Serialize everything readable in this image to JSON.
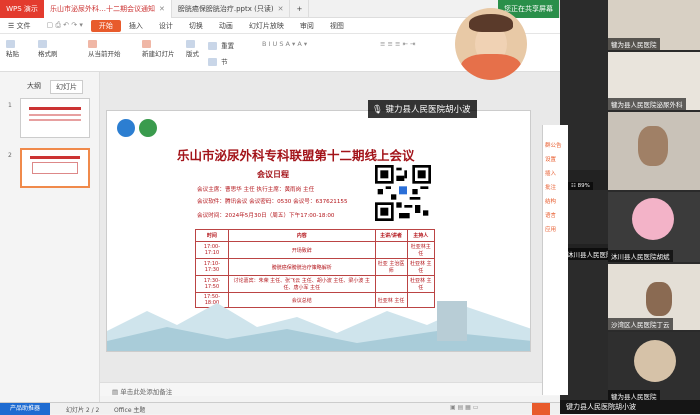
{
  "titlebar": {
    "app_name": "WPS 演示",
    "tabs": [
      {
        "label": "乐山市泌尿外科…十二期会议通知",
        "active": true
      },
      {
        "label": "膀胱癌保膀胱治疗.pptx (只读)",
        "active": false
      }
    ],
    "shared_screen_label": "您正在共享屏幕"
  },
  "menubar": {
    "file": "文件",
    "items": [
      "开始",
      "插入",
      "设计",
      "切换",
      "动画",
      "幻灯片放映",
      "审阅",
      "视图"
    ],
    "active": "开始"
  },
  "toolbar": {
    "paste": "粘贴",
    "format_painter": "格式刷",
    "from_current": "从当前开始",
    "new_slide": "新建幻灯片",
    "layout": "版式",
    "reset": "重置",
    "section": "节"
  },
  "leftpane": {
    "tabs": [
      "大纲",
      "幻灯片"
    ],
    "active_tab": "幻灯片",
    "slides": [
      {
        "num": "1"
      },
      {
        "num": "2"
      }
    ]
  },
  "slide": {
    "title": "乐山市泌尿外科专科联盟第十二期线上会议",
    "schedule_heading": "会议日程",
    "chair": "会议主席：曹思华 主任   执行主席：黄雨岗 主任",
    "software": "会议软件：腾讯会议   会议密码：0530   会议号：637621155",
    "time": "会议时间：2024年5月30日（周五）下午17:00-18:00",
    "agenda_headers": [
      "时间",
      "内容",
      "主讲/讲者",
      "主持人"
    ],
    "agenda_rows": [
      [
        "17:00-17:10",
        "开场致辞",
        "",
        "杜亚林主任"
      ],
      [
        "17:10-17:30",
        "膀胱癌保膀胱治疗策略解析",
        "杜亚 主治医师",
        "杜亚林 主任"
      ],
      [
        "17:30-17:50",
        "讨论嘉宾：朱荣 主任、张飞云 主任、胡小波 主任、梁小波 主任、唐小军 主任",
        "",
        "杜亚林 主任"
      ],
      [
        "17:50-18:00",
        "会议总结",
        "杜亚林 主任",
        ""
      ]
    ]
  },
  "notes": {
    "placeholder": "单击此处添加备注"
  },
  "statusbar": {
    "reset_button": "产品助推器",
    "slide_indicator": "幻灯片 2 / 2",
    "theme": "Office 主题"
  },
  "video": {
    "speaker_name": "键力县人民医院胡小波",
    "participants": [
      {
        "name": "犍为县人民医院"
      },
      {
        "name": "沐川县人民医院"
      },
      {
        "name": "犍为县人民医院泌尿外科"
      },
      {
        "name": "沐川县人民医院胡斌"
      },
      {
        "name": "沙湾区人民医院丁云"
      },
      {
        "name": "犍为县人民医院"
      }
    ],
    "side_labels": [
      "群公告",
      "设置",
      "插入",
      "批注",
      "结构",
      "语言",
      "应用"
    ]
  }
}
